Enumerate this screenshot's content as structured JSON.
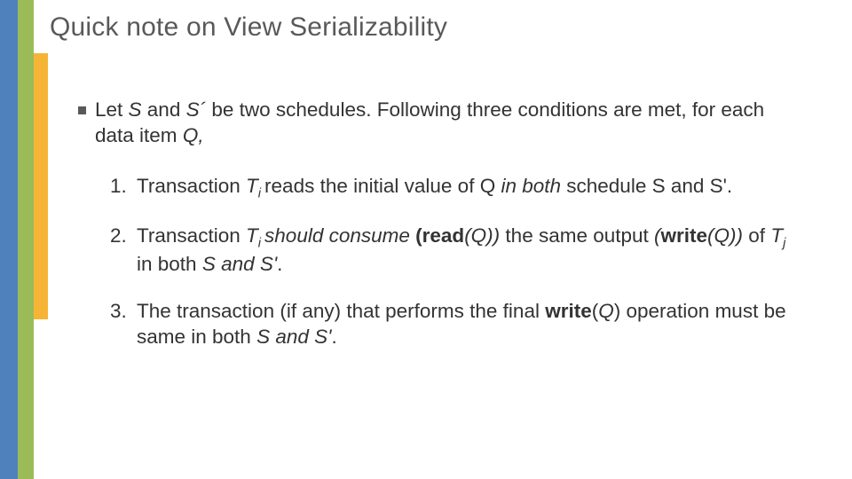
{
  "title": "Quick note on View Serializability",
  "intro": {
    "parts": [
      "Let ",
      "S",
      " and ",
      "S´",
      " be two schedules. Following three conditions are met, for each data item ",
      "Q,",
      ""
    ]
  },
  "items": [
    {
      "num": "1.",
      "p": [
        "Transaction ",
        "T",
        "i ",
        "reads the initial value of Q ",
        "in both",
        " schedule S and S'."
      ]
    },
    {
      "num": "2.",
      "p": [
        "Transaction ",
        "T",
        "i ",
        "should consume ",
        "(read",
        "(Q))",
        " the same output ",
        "(",
        "write",
        "(Q))",
        " of ",
        "T",
        "j",
        "  in both ",
        "S and S'",
        "."
      ]
    },
    {
      "num": "3.",
      "p": [
        "The transaction (if any) that performs the final ",
        "write",
        "(",
        "Q",
        ") operation must be same in both ",
        "S and S'",
        "."
      ]
    }
  ]
}
